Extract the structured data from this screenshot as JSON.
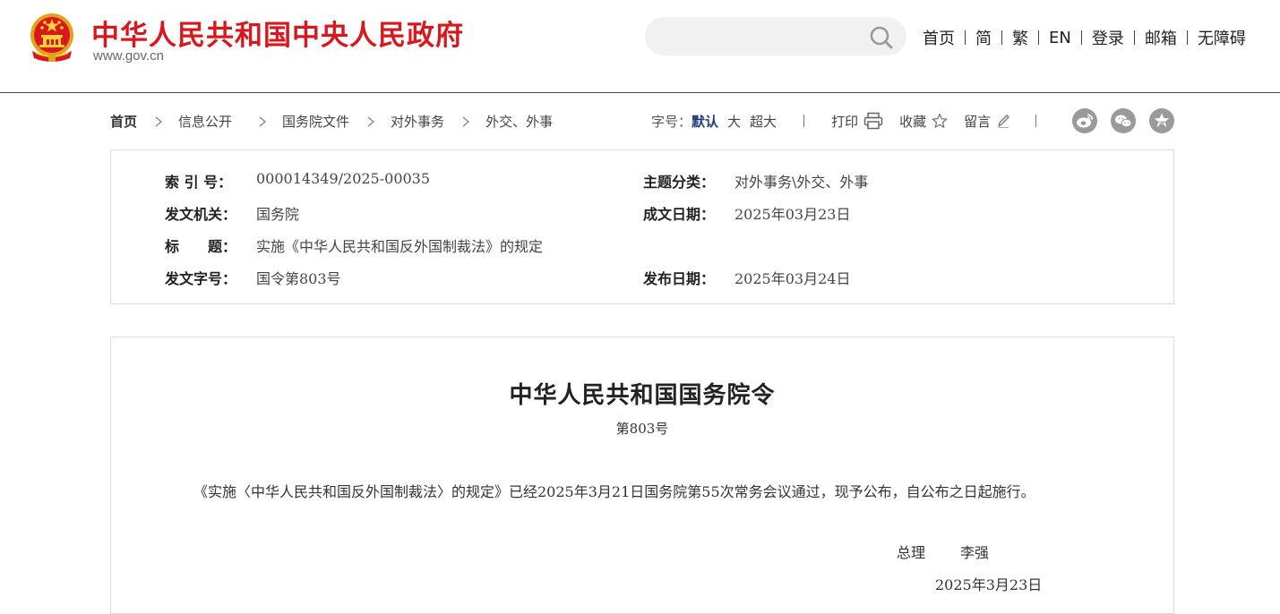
{
  "header": {
    "site_title": "中华人民共和国中央人民政府",
    "site_domain": "www.gov.cn",
    "search_placeholder": "",
    "nav": [
      "首页",
      "简",
      "繁",
      "EN",
      "登录",
      "邮箱",
      "无障碍"
    ],
    "colors": {
      "brand_red": "#d8181c",
      "emblem_gold": "#f1c232"
    }
  },
  "breadcrumb": [
    "首页",
    "信息公开",
    "国务院文件",
    "对外事务",
    "外交、外事"
  ],
  "toolbar": {
    "font_size_label": "字号：",
    "font_sizes": [
      "默认",
      "大",
      "超大"
    ],
    "print_label": "打印",
    "favorite_label": "收藏",
    "comment_label": "留言",
    "share_icons": [
      "weibo-icon",
      "wechat-icon",
      "qzone-icon"
    ]
  },
  "info": {
    "index_label": "索 引 号：",
    "index_value": "000014349/2025-00035",
    "topic_label": "主题分类：",
    "topic_value": "对外事务\\外交、外事",
    "issuer_label": "发文机关：",
    "issuer_value": "国务院",
    "created_label": "成文日期：",
    "created_value": "2025年03月23日",
    "title_label": "标　　题：",
    "title_value": "实施《中华人民共和国反外国制裁法》的规定",
    "doc_no_label": "发文字号：",
    "doc_no_value": "国令第803号",
    "published_label": "发布日期：",
    "published_value": "2025年03月24日"
  },
  "document": {
    "title": "中华人民共和国国务院令",
    "number": "第803号",
    "body": "《实施〈中华人民共和国反外国制裁法〉的规定》已经2025年3月21日国务院第55次常务会议通过，现予公布，自公布之日起施行。",
    "sign_title": "总理",
    "sign_name": "李强",
    "sign_date": "2025年3月23日"
  }
}
